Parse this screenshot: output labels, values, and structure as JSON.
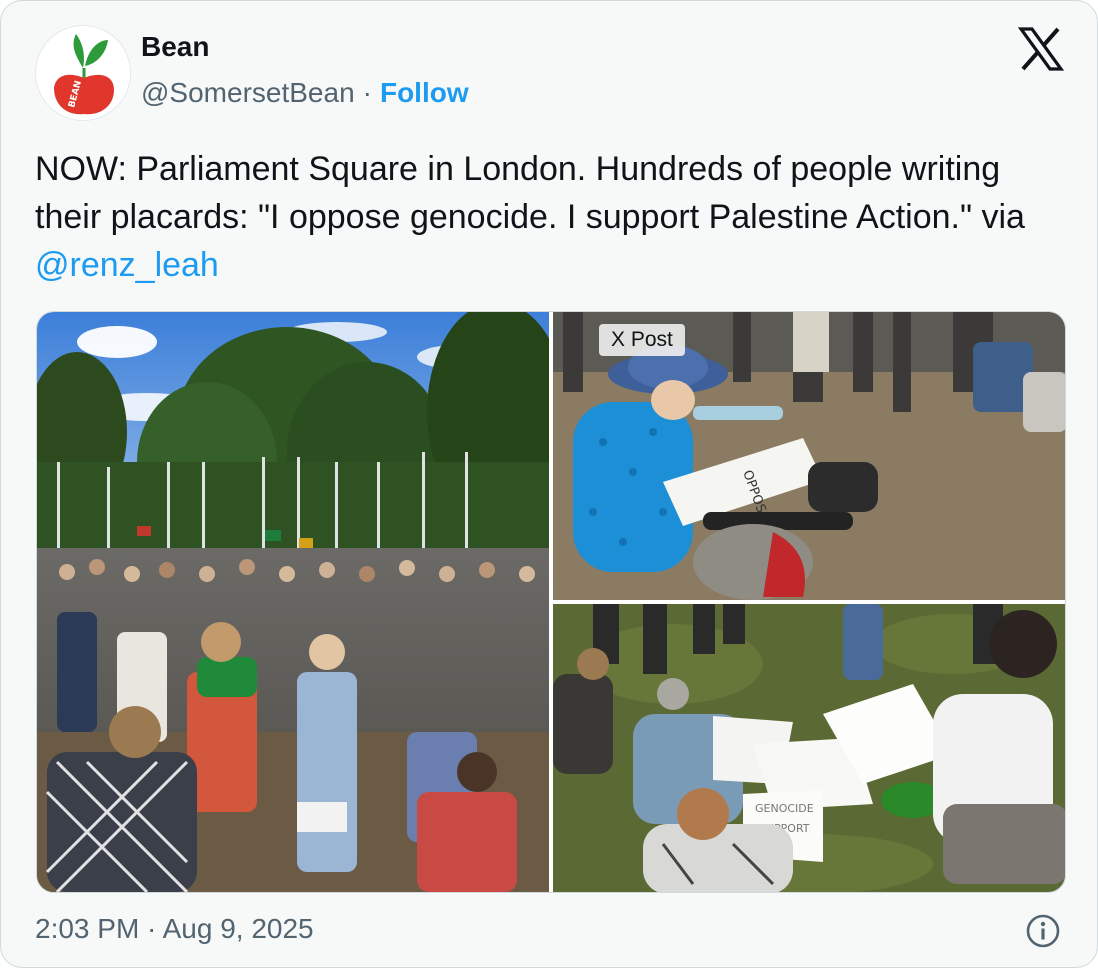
{
  "author": {
    "name": "Bean",
    "handle": "@SomersetBean",
    "separator": "·",
    "follow_label": "Follow",
    "avatar_text": "BEAN",
    "avatar_icon": "bean-logo-icon"
  },
  "brand": {
    "logo_icon": "x-logo-icon"
  },
  "tweet": {
    "text_main": "NOW: Parliament Square in London. Hundreds of people writing their placards: \"I oppose genocide. I support Palestine Action.\" via ",
    "mention": "@renz_leah"
  },
  "media": {
    "badge": "X Post",
    "photos": [
      {
        "icon": "crowd-photo"
      },
      {
        "icon": "woman-writing-placard-photo"
      },
      {
        "icon": "people-writing-placards-photo"
      }
    ],
    "placard_texts": [
      "OPPOSE",
      "GENOCIDE",
      "SUPPORT"
    ]
  },
  "footer": {
    "timestamp": "2:03 PM · Aug 9, 2025",
    "info_icon": "info-icon"
  },
  "colors": {
    "link": "#1d9bf0",
    "text": "#0f1419",
    "muted": "#536471",
    "card_bg": "#f7f9f9"
  }
}
